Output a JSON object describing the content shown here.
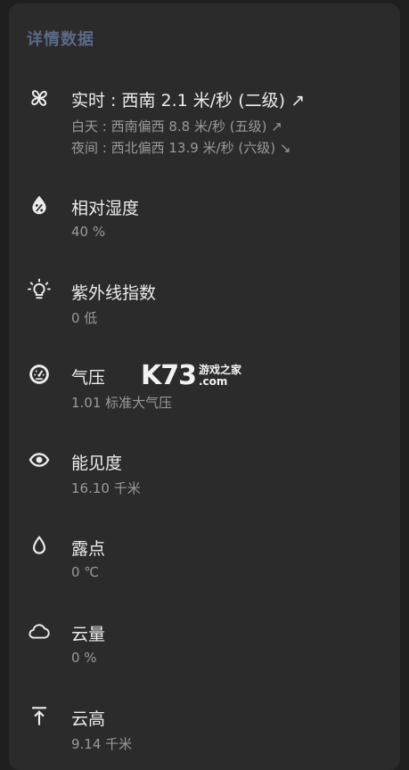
{
  "section_title": "详情数据",
  "wind": {
    "icon": "fan-icon",
    "realtime": "实时 : 西南 2.1 米/秒 (二级) ↗",
    "day": "白天 : 西南偏西 8.8 米/秒 (五级) ↗",
    "night": "夜间 : 西北偏西 13.9 米/秒 (六级) ↘"
  },
  "humidity": {
    "icon": "humidity-drop-icon",
    "label": "相对湿度",
    "value": "40 %"
  },
  "uv": {
    "icon": "lightbulb-icon",
    "label": "紫外线指数",
    "value": "0 低"
  },
  "pressure": {
    "icon": "gauge-icon",
    "label": "气压",
    "value": "1.01 标准大气压"
  },
  "visibility": {
    "icon": "eye-icon",
    "label": "能见度",
    "value": "16.10 千米"
  },
  "dew_point": {
    "icon": "drop-icon",
    "label": "露点",
    "value": "0 ℃"
  },
  "cloud_cover": {
    "icon": "cloud-icon",
    "label": "云量",
    "value": "0 %"
  },
  "cloud_height": {
    "icon": "arrow-up-bar-icon",
    "label": "云高",
    "value": "9.14 千米"
  },
  "watermark": {
    "logo": "K73",
    "cn": "游戏之家",
    "domain": ".com"
  }
}
